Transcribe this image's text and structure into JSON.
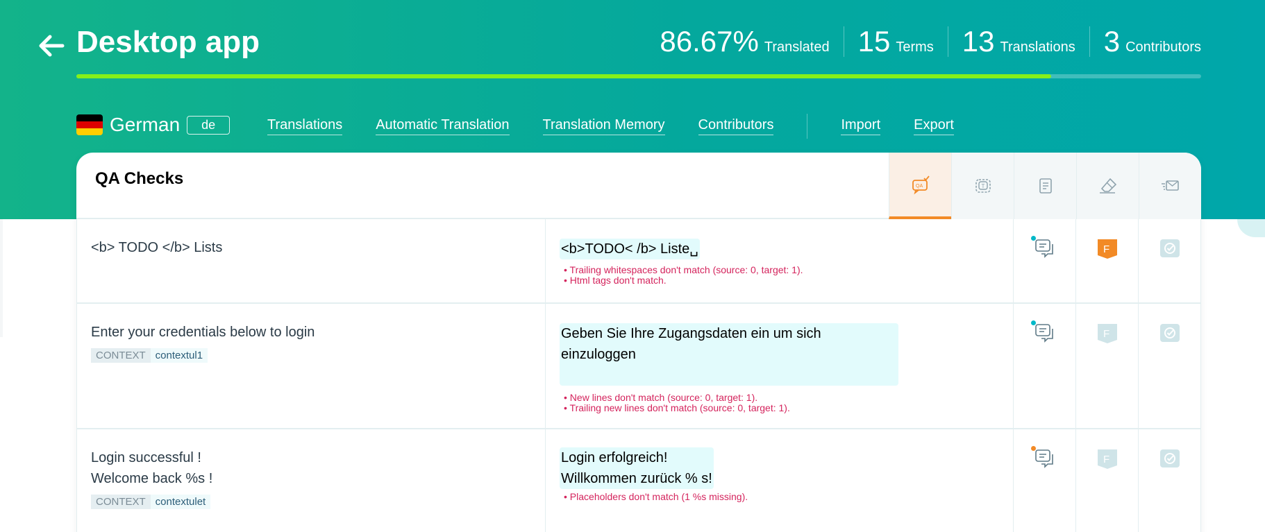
{
  "header": {
    "title": "Desktop app",
    "stats": [
      {
        "value": "86.67%",
        "label": "Translated"
      },
      {
        "value": "15",
        "label": "Terms"
      },
      {
        "value": "13",
        "label": "Translations"
      },
      {
        "value": "3",
        "label": "Contributors"
      }
    ],
    "progress": 0.8667
  },
  "language": {
    "name": "German",
    "code": "de"
  },
  "nav": {
    "translations": "Translations",
    "automatic_translation": "Automatic Translation",
    "translation_memory": "Translation Memory",
    "contributors": "Contributors",
    "import": "Import",
    "export": "Export"
  },
  "panel": {
    "title": "QA Checks",
    "tools": [
      "qa-check-icon",
      "term-icon",
      "document-icon",
      "eraser-icon",
      "send-icon"
    ]
  },
  "rows": [
    {
      "source": "<b> TODO </b> Lists",
      "target": "<b>TODO< /b> Liste␣",
      "errors": [
        "Trailing whitespaces don't match (source: 0, target: 1).",
        "Html tags don't match."
      ],
      "comment_dot": "#00b8c8",
      "fuzzy_active": true,
      "fuzzy_label": "F"
    },
    {
      "source": "Enter your credentials below to login",
      "context_label": "CONTEXT",
      "context_value": "contextul1",
      "target": "Geben Sie Ihre Zugangsdaten ein um sich einzuloggen",
      "errors": [
        "New lines don't match (source: 0, target: 1).",
        "Trailing new lines don't match (source: 0, target: 1)."
      ],
      "comment_dot": "#00b8c8",
      "fuzzy_active": false,
      "fuzzy_label": "F"
    },
    {
      "source_line1": "Login successful !",
      "source_line2": "Welcome back %s !",
      "context_label": "CONTEXT",
      "context_value": "contextulet",
      "target_line1": "Login erfolgreich!",
      "target_line2": "Willkommen zurück % s!",
      "errors": [
        "Placeholders don't match (1 %s missing)."
      ],
      "comment_dot": "#f28a26",
      "fuzzy_active": false,
      "fuzzy_label": "F"
    }
  ]
}
